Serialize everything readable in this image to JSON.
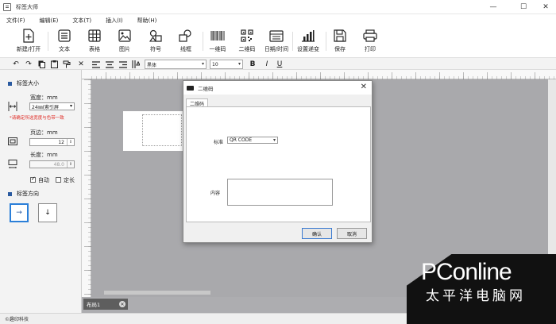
{
  "window": {
    "title": "标签大师",
    "controls": {
      "minimize": "—",
      "maximize": "☐",
      "close": "✕"
    }
  },
  "menu": [
    "文件(F)",
    "编辑(E)",
    "文本(T)",
    "插入(I)",
    "帮助(H)"
  ],
  "toolbar": {
    "new_open": "新建/打开",
    "text": "文本",
    "table": "表格",
    "image": "图片",
    "symbol": "符号",
    "line": "线框",
    "barcode": "一维码",
    "qrcode": "二维码",
    "datetime": "日期/时间",
    "settings": "设置递变",
    "save": "保存",
    "print": "打印"
  },
  "format_bar": {
    "font": "黑体",
    "size": "10",
    "bold": "B",
    "italic": "I",
    "underline": "U"
  },
  "left_panel": {
    "size_section": "标签大小",
    "width_label": "宽度：mm",
    "width_value": "24㎜(索引屏",
    "warning": "*请确定所选宽度与色带一致",
    "margin_label": "页边：mm",
    "margin_value": "12",
    "length_label": "长度：mm",
    "length_value": "48.0",
    "auto_label": "自动",
    "fixed_label": "定长",
    "auto_checked": true,
    "fixed_checked": false,
    "orientation_section": "标签方向"
  },
  "canvas": {
    "layout_tab": "布局1"
  },
  "status": {
    "text": "©趣印科技"
  },
  "dialog": {
    "title": "二维码",
    "tab": "二维码",
    "standard_label": "标准",
    "standard_value": "QR CODE",
    "content_label": "内容",
    "content_value": "",
    "ok": "确认",
    "cancel": "取消"
  },
  "watermark": {
    "logo": "PConline",
    "subtitle": "太平洋电脑网"
  },
  "colors": {
    "accent": "#2a5aa0",
    "warning": "#e0302a",
    "canvas": "#adadb0"
  }
}
